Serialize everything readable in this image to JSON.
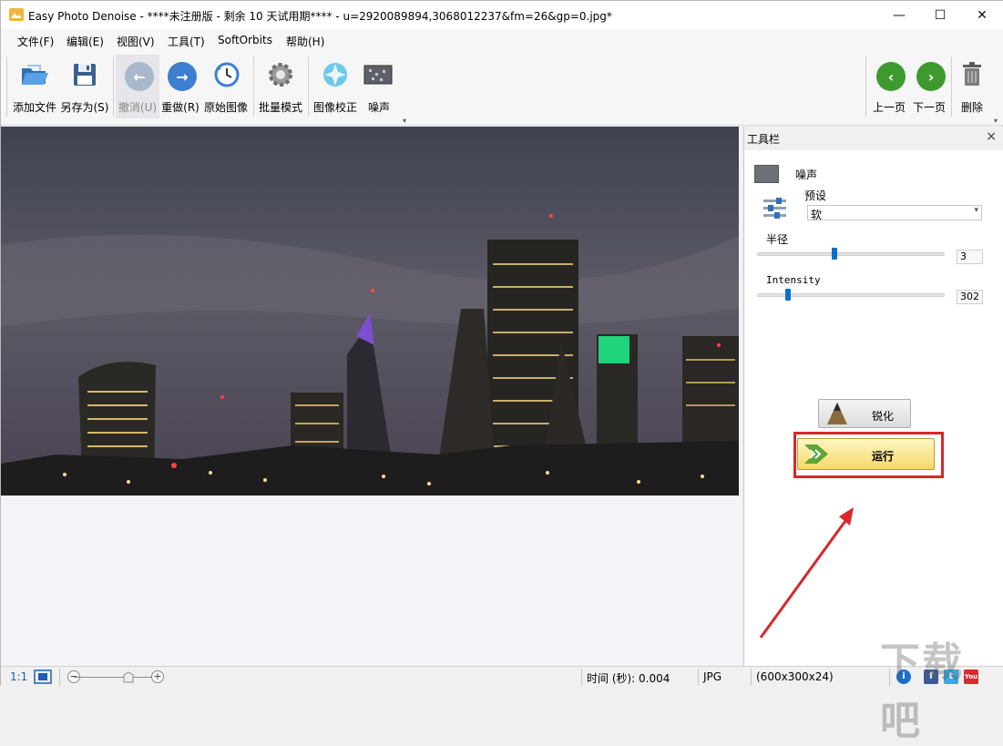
{
  "window": {
    "title": "Easy Photo Denoise - ****未注册版 - 剩余 10 天试用期**** - u=2920089894,3068012237&fm=26&gp=0.jpg*",
    "minimize": "—",
    "maximize": "☐",
    "close": "✕"
  },
  "menu": [
    "文件(F)",
    "编辑(E)",
    "视图(V)",
    "工具(T)",
    "SoftOrbits",
    "帮助(H)"
  ],
  "toolbar": {
    "add_file": "添加文件",
    "save_as": "另存为(S)",
    "undo": "撤消(U)",
    "redo": "重做(R)",
    "original": "原始图像",
    "batch": "批量模式",
    "correction": "图像校正",
    "noise": "噪声",
    "prev": "上一页",
    "next": "下一页",
    "delete": "删除"
  },
  "panel": {
    "title": "工具栏",
    "close": "×",
    "noise_title": "噪声",
    "preset_label": "预设",
    "preset_value": "软",
    "radius_label": "半径",
    "radius_value": "3",
    "radius_level": 0.41,
    "intensity_label": "Intensity",
    "intensity_value": "302",
    "intensity_level": 0.15,
    "sharpen_label": "锐化",
    "run_label": "运行"
  },
  "status": {
    "ratio": "1:1",
    "time": "时间 (秒): 0.004",
    "format": "JPG",
    "size": "(600x300x24)"
  },
  "watermark": "下载吧",
  "colors": {
    "accent": "#0a6ed1",
    "highlight": "#d9262b",
    "run_button": "#f6d96a",
    "nav_green": "#3e9a2f"
  }
}
